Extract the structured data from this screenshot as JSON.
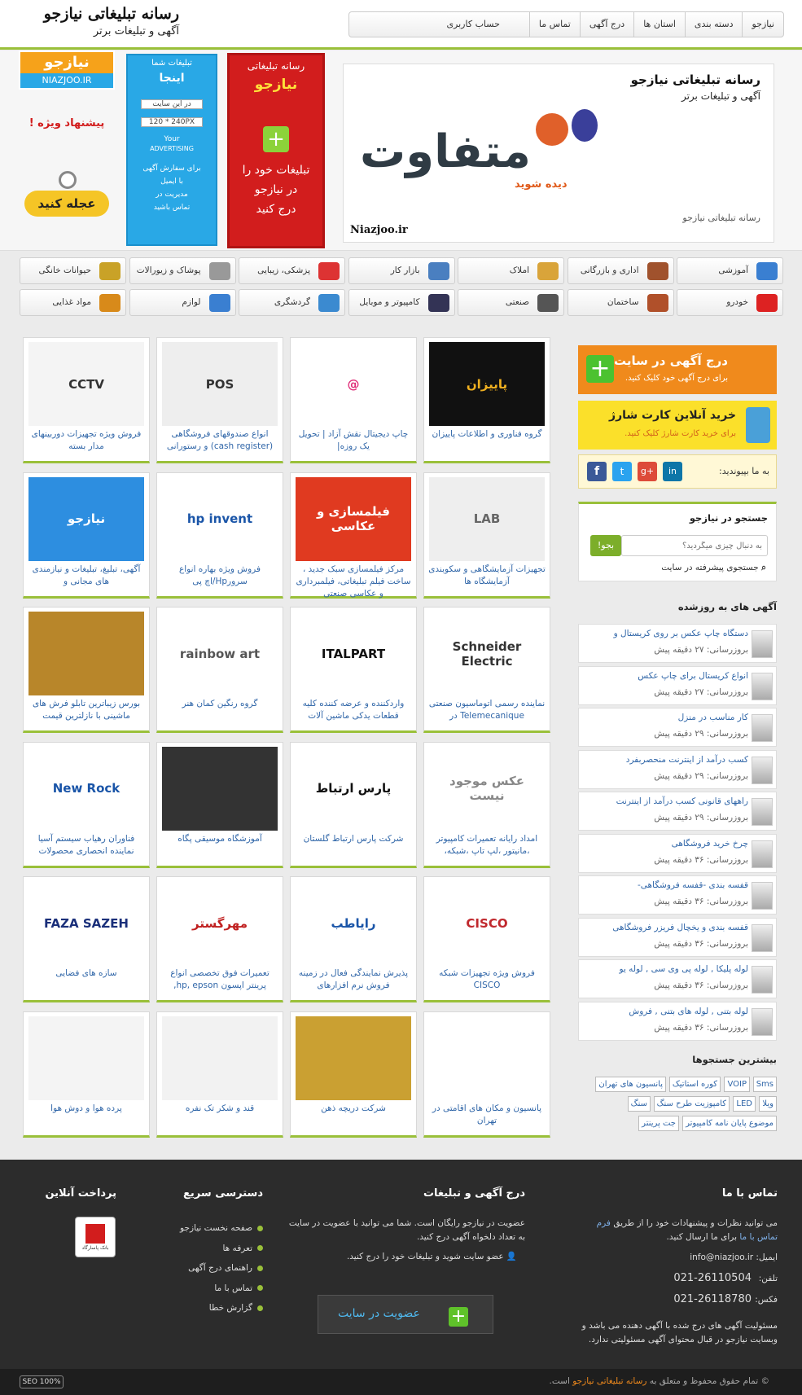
{
  "header": {
    "logo_line1": "رسانه تبلیغاتی نیازجو",
    "logo_line2": "آگهی و تبلیغات برتر",
    "nav": [
      "نیازجو",
      "دسته بندی",
      "استان ها",
      "درج آگهی",
      "تماس ما",
      "حساب کاربری"
    ]
  },
  "banners": {
    "main_title": "رسانه تبلیغاتی نیازجو",
    "main_sub": "آگهی و تبلیغات برتر",
    "main_big": "متفاوت",
    "main_see": "دیده شوید",
    "main_caption": "رسانه تبلیغاتی نیازجو",
    "main_site": "Niazjoo.ir",
    "red_line1": "رسانه تبلیغاتی",
    "red_line2": "نیازجو",
    "red_line3": "تبلیغات خود را",
    "red_line4": "در نیازجو",
    "red_line5": "درج کنید",
    "blue_line1": "تبلیغات شما",
    "blue_line2": "اینجا",
    "blue_line3": "در این سایت",
    "blue_size": "120 * 240PX",
    "blue_line4": "Your",
    "blue_line5": "ADVERTISING",
    "blue_line6": "برای سفارش آگهی",
    "blue_line7": "با ایمیل",
    "blue_line8": "مدیریت در",
    "blue_line9": "تماس باشید",
    "left_logo_fa": "نیازجو",
    "left_logo_en": "NIAZJOO.IR",
    "left_offer": "پیشنهاد ویژه !",
    "left_btn": "عجله کنید"
  },
  "categories": [
    {
      "label": "آموزشی",
      "icon": "pencil-ruler-icon",
      "color": "#3a7fd1"
    },
    {
      "label": "اداری و بازرگانی",
      "icon": "briefcase-icon",
      "color": "#a0522d"
    },
    {
      "label": "املاک",
      "icon": "house-icon",
      "color": "#d9a43a"
    },
    {
      "label": "بازار کار",
      "icon": "worker-icon",
      "color": "#4a7fc0"
    },
    {
      "label": "پزشکی، زیبایی",
      "icon": "medical-icon",
      "color": "#d33"
    },
    {
      "label": "پوشاک و زیورالات",
      "icon": "shoe-icon",
      "color": "#999"
    },
    {
      "label": "حیوانات خانگی",
      "icon": "pet-icon",
      "color": "#c9a227"
    },
    {
      "label": "خودرو",
      "icon": "car-icon",
      "color": "#d22"
    },
    {
      "label": "ساختمان",
      "icon": "brick-icon",
      "color": "#b0502a"
    },
    {
      "label": "صنعتی",
      "icon": "gear-icon",
      "color": "#555"
    },
    {
      "label": "کامپیوتر و موبایل",
      "icon": "laptop-icon",
      "color": "#335"
    },
    {
      "label": "گردشگری",
      "icon": "globe-icon",
      "color": "#3b8ad0"
    },
    {
      "label": "لوازم",
      "icon": "sofa-icon",
      "color": "#3a7fd1"
    },
    {
      "label": "مواد غذایی",
      "icon": "burger-icon",
      "color": "#d88a1a"
    }
  ],
  "listings": [
    {
      "caption": "گروه فناوری و اطلاعات پاییزان",
      "thumb": "پاییزان",
      "bg": "#111",
      "fg": "#f0b020"
    },
    {
      "caption": "چاپ دیجیتال نقش آزاد | تحویل یک روزه|",
      "thumb": "@",
      "bg": "#fff",
      "fg": "#e0307a"
    },
    {
      "caption": "انواع صندوقهای فروشگاهی (cash register) و رستورانی",
      "thumb": "POS",
      "bg": "#eee",
      "fg": "#333"
    },
    {
      "caption": "فروش ویژه تجهیزات دوربینهای مدار بسته",
      "thumb": "CCTV",
      "bg": "#f4f4f4",
      "fg": "#333"
    },
    {
      "caption": "تجهیزات آزمایشگاهی و سکوبندی آزمایشگاه ها",
      "thumb": "LAB",
      "bg": "#eee",
      "fg": "#666"
    },
    {
      "caption": "مرکز فیلمسازی سبک جدید ، ساخت فیلم تبلیغاتی، فیلمبرداری و عکاسی صنعتی",
      "thumb": "فیلمسازی و عکاسی",
      "bg": "#e03a20",
      "fg": "#fff"
    },
    {
      "caption": "فروش ویژه بهاره انواع سرورHp/اچ پی",
      "thumb": "hp invent",
      "bg": "#fff",
      "fg": "#1a55a8"
    },
    {
      "caption": "آگهی، تبلیغ، تبلیغات و نیازمندی های مجانی و",
      "thumb": "نیازجو",
      "bg": "#2d8ee0",
      "fg": "#fff"
    },
    {
      "caption": "نماینده رسمی اتوماسیون صنعتی Telemecanique در",
      "thumb": "Schneider Electric",
      "bg": "#fff",
      "fg": "#333"
    },
    {
      "caption": "واردکننده و عرضه کننده کلیه قطعات یدکی ماشین آلات",
      "thumb": "ITALPART",
      "bg": "#fff",
      "fg": "#111"
    },
    {
      "caption": "گروه رنگین کمان هنر",
      "thumb": "rainbow art",
      "bg": "#fff",
      "fg": "#555"
    },
    {
      "caption": "بورس زیباترین تابلو فرش های ماشینی با نازلترین قیمت",
      "thumb": "",
      "bg": "#b8862a",
      "fg": "#fff"
    },
    {
      "caption": "امداد رایانه تعمیرات کامپیوتر ،مانیتور ،لپ تاپ ،شبکه،",
      "thumb": "عکس موجود نیست",
      "bg": "#fff",
      "fg": "#888"
    },
    {
      "caption": "شرکت پارس ارتباط گلستان",
      "thumb": "پارس ارتباط",
      "bg": "#fff",
      "fg": "#111"
    },
    {
      "caption": "آموزشگاه موسیقی پگاه",
      "thumb": "",
      "bg": "#333",
      "fg": "#fff"
    },
    {
      "caption": "فناوران رهیاب سیستم آسیا نماینده انحصاری محصولات",
      "thumb": "New Rock",
      "bg": "#fff",
      "fg": "#1a55a8"
    },
    {
      "caption": "فروش ویژه تجهیزات شبکه CISCO",
      "thumb": "CISCO",
      "bg": "#fff",
      "fg": "#c0282d"
    },
    {
      "caption": "پذیرش نمایندگی فعال در زمینه فروش نرم افزارهای",
      "thumb": "رایاطب",
      "bg": "#fff",
      "fg": "#1a55a8"
    },
    {
      "caption": "تعمیرات فوق تخصصی انواع پرینتر اپسون hp, epson,",
      "thumb": "مهرگستر",
      "bg": "#fff",
      "fg": "#c02020"
    },
    {
      "caption": "سازه های فضایی",
      "thumb": "FAZA SAZEH",
      "bg": "#fff",
      "fg": "#1a2f7a"
    },
    {
      "caption": "پانسیون و مکان های اقامتی در تهران",
      "thumb": "",
      "bg": "#fff",
      "fg": "#1a55a8"
    },
    {
      "caption": "شرکت دریچه ذهن",
      "thumb": "",
      "bg": "#caa032",
      "fg": "#fff"
    },
    {
      "caption": "قند و شکر تک نفره",
      "thumb": "",
      "bg": "#f2f2f2",
      "fg": "#333"
    },
    {
      "caption": "پرده هوا و دوش هوا",
      "thumb": "",
      "bg": "#f4f4f4",
      "fg": "#999"
    }
  ],
  "sidebar": {
    "ad_title": "درج آگهی در سایت",
    "ad_sub": "برای درج آگهی خود کلیک کنید.",
    "charge_title": "خرید آنلاین کارت شارژ",
    "charge_sub": "برای خرید کارت شارژ کلیک کنید.",
    "join_label": "به ما بپیوندید:",
    "search_title": "جستجو در نیازجو",
    "search_placeholder": "به دنبال چیزی میگردید؟",
    "search_button": "بجو!",
    "advanced_search": "جستجوی پیشرفته در سایت",
    "latest_title": "آگهی های به روزشده",
    "latest": [
      {
        "title": "دستگاه چاپ عکس بر روی کریستال و",
        "time": "بروزرسانی: ۲۷ دقیقه پیش"
      },
      {
        "title": "انواع کریستال برای چاپ عکس",
        "time": "بروزرسانی: ۲۷ دقیقه پیش"
      },
      {
        "title": "کار مناسب در منزل",
        "time": "بروزرسانی: ۲۹ دقیقه پیش"
      },
      {
        "title": "کسب درآمد از اینترنت منحصربفرد",
        "time": "بروزرسانی: ۲۹ دقیقه پیش"
      },
      {
        "title": "راههای قانونی کسب درآمد از اینترنت",
        "time": "بروزرسانی: ۲۹ دقیقه پیش"
      },
      {
        "title": "چرخ خرید فروشگاهی",
        "time": "بروزرسانی: ۳۶ دقیقه پیش"
      },
      {
        "title": "قفسه بندی -قفسه فروشگاهی-",
        "time": "بروزرسانی: ۳۶ دقیقه پیش"
      },
      {
        "title": "قفسه بندی و یخچال فریزر فروشگاهی",
        "time": "بروزرسانی: ۳۶ دقیقه پیش"
      },
      {
        "title": "لوله پلیکا , لوله پی وی سی , لوله یو",
        "time": "بروزرسانی: ۳۶ دقیقه پیش"
      },
      {
        "title": "لوله بتنی , لوله های بتنی , فروش",
        "time": "بروزرسانی: ۳۶ دقیقه پیش"
      }
    ],
    "searches_title": "بیشترین جستجوها",
    "tags": [
      "Sms",
      "VOIP",
      "کوره استاتیک",
      "پانسیون های تهران",
      "ویلا",
      "LED",
      "کامپوزیت طرح سنگ",
      "سنگ",
      "موضوع پایان نامه کامپیوتر",
      "جت پرینتر"
    ]
  },
  "footer": {
    "contact_title": "تماس با ما",
    "contact_text1": "می توانید نظرات و پیشنهادات خود را از طریق",
    "contact_link": "فرم تماس با ما",
    "contact_text2": "برای ما ارسال کنید.",
    "email": "ایمیل: info@niazjoo.ir",
    "phone_label": "تلفن:",
    "phone": "021-26110504",
    "fax_label": "فکس:",
    "fax": "021-26118780",
    "disclaimer": "مسئولیت آگهی های درج شده با آگهی دهنده می باشد و وبسایت نیازجو در قبال محتوای آگهی مسئولیتی ندارد.",
    "post_title": "درج آگهی و تبلیغات",
    "post_text": "عضویت در نیازجو رایگان است. شما می توانید با عضویت در سایت به تعداد دلخواه آگهی درج کنید.",
    "post_line": "عضو سایت شوید و تبلیغات خود را درج کنید.",
    "post_button": "عضویت در سایت",
    "quick_title": "دسترسی سریع",
    "quick_links": [
      "صفحه نخست نیازجو",
      "تعرفه ها",
      "راهنمای درج آگهی",
      "تماس با ما",
      "گزارش خطا"
    ],
    "pay_title": "پرداخت آنلاین",
    "bank": "بانک پاسارگاد",
    "copyright_pre": "© تمام حقوق محفوظ و متعلق به",
    "copyright_brand": "رسانه تبلیغاتی نیازجو",
    "copyright_post": "است.",
    "seo_badge": "SEO 100%"
  },
  "colors": {
    "accent": "#9ac03a",
    "link": "#3066a8",
    "orange": "#f08a1c"
  }
}
